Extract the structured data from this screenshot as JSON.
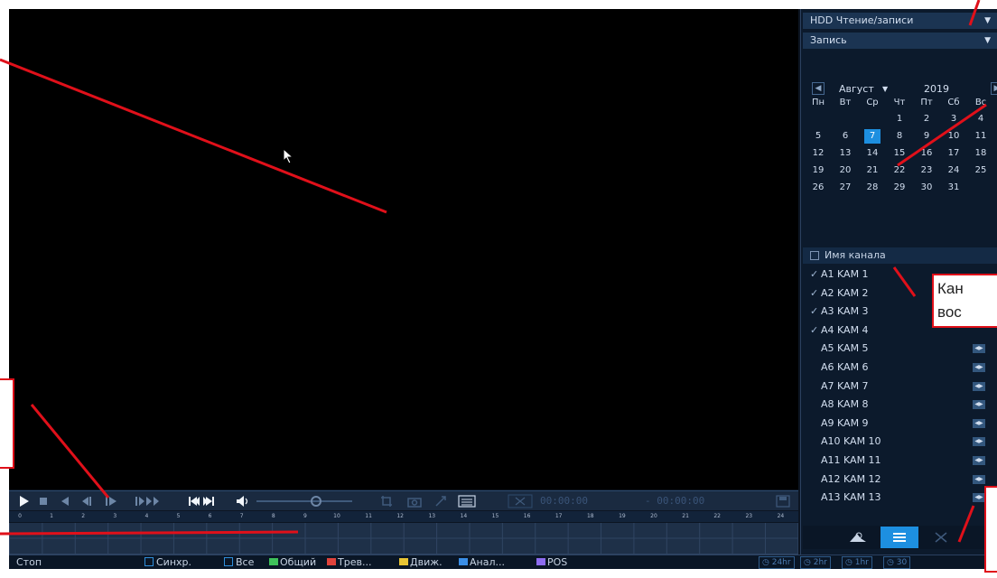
{
  "panel": {
    "storage_select": "HDD Чтение/записи",
    "type_select": "Запись",
    "calendar": {
      "month": "Август",
      "year": "2019",
      "weekdays": [
        "Пн",
        "Вт",
        "Ср",
        "Чт",
        "Пт",
        "Сб",
        "Вс"
      ],
      "rows": [
        [
          "",
          "",
          "",
          "1",
          "2",
          "3",
          "4"
        ],
        [
          "5",
          "6",
          "7",
          "8",
          "9",
          "10",
          "11"
        ],
        [
          "12",
          "13",
          "14",
          "15",
          "16",
          "17",
          "18"
        ],
        [
          "19",
          "20",
          "21",
          "22",
          "23",
          "24",
          "25"
        ],
        [
          "26",
          "27",
          "28",
          "29",
          "30",
          "31",
          ""
        ]
      ],
      "selected_day": "7"
    },
    "channel_header": "Имя канала",
    "channels": [
      {
        "name": "A1 KAM 1",
        "checked": true
      },
      {
        "name": "A2 KAM 2",
        "checked": true
      },
      {
        "name": "A3 KAM 3",
        "checked": true
      },
      {
        "name": "A4 KAM 4",
        "checked": true
      },
      {
        "name": "A5 KAM 5",
        "checked": false
      },
      {
        "name": "A6 KAM 6",
        "checked": false
      },
      {
        "name": "A7 KAM 7",
        "checked": false
      },
      {
        "name": "A8 KAM 8",
        "checked": false
      },
      {
        "name": "A9 KAM 9",
        "checked": false
      },
      {
        "name": "A10 KAM 10",
        "checked": false
      },
      {
        "name": "A11 KAM 11",
        "checked": false
      },
      {
        "name": "A12 KAM 12",
        "checked": false
      },
      {
        "name": "A13 KAM 13",
        "checked": false
      }
    ]
  },
  "controls": {
    "time_start": "00:00:00",
    "time_end": "- 00:00:00",
    "hours": [
      "0",
      "1",
      "2",
      "3",
      "4",
      "5",
      "6",
      "7",
      "8",
      "9",
      "10",
      "11",
      "12",
      "13",
      "14",
      "15",
      "16",
      "17",
      "18",
      "19",
      "20",
      "21",
      "22",
      "23",
      "24"
    ]
  },
  "status": {
    "state": "Стоп",
    "sync": "Синхр.",
    "all": "Все",
    "legend": [
      {
        "label": "Общий",
        "color": "#3ec15a"
      },
      {
        "label": "Трев...",
        "color": "#e0433c"
      },
      {
        "label": "Движ.",
        "color": "#e8c534"
      },
      {
        "label": "Анал...",
        "color": "#3a8ee6"
      },
      {
        "label": "POS",
        "color": "#8d6cf0"
      }
    ],
    "zoom": [
      "24hr",
      "2hr",
      "1hr",
      "30"
    ]
  },
  "callouts": {
    "channel_line1": "Кан",
    "channel_line2": "вос"
  }
}
